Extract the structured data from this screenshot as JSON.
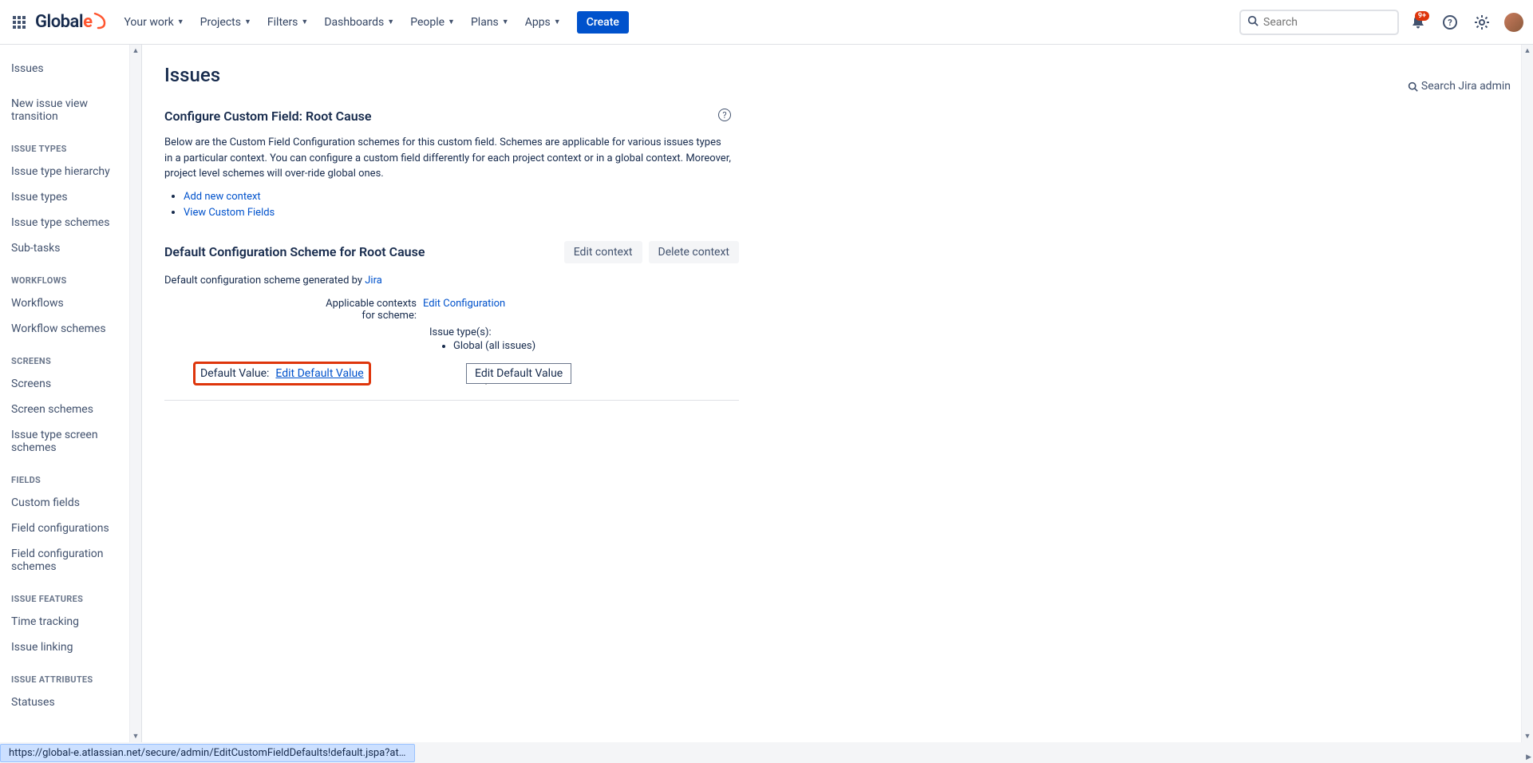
{
  "nav": {
    "logo1": "Global",
    "logo2": "e",
    "items": [
      "Your work",
      "Projects",
      "Filters",
      "Dashboards",
      "People",
      "Plans",
      "Apps"
    ],
    "create": "Create",
    "search_placeholder": "Search",
    "badge": "9+"
  },
  "admin_search": "Search Jira admin",
  "sidebar": {
    "head": "Issues",
    "new_view": "New issue view transition",
    "sections": [
      {
        "title": "ISSUE TYPES",
        "items": [
          "Issue type hierarchy",
          "Issue types",
          "Issue type schemes",
          "Sub-tasks"
        ]
      },
      {
        "title": "WORKFLOWS",
        "items": [
          "Workflows",
          "Workflow schemes"
        ]
      },
      {
        "title": "SCREENS",
        "items": [
          "Screens",
          "Screen schemes",
          "Issue type screen schemes"
        ]
      },
      {
        "title": "FIELDS",
        "items": [
          "Custom fields",
          "Field configurations",
          "Field configuration schemes"
        ]
      },
      {
        "title": "ISSUE FEATURES",
        "items": [
          "Time tracking",
          "Issue linking"
        ]
      },
      {
        "title": "ISSUE ATTRIBUTES",
        "items": [
          "Statuses"
        ]
      }
    ]
  },
  "main": {
    "title": "Issues",
    "sub_header": "Configure Custom Field: Root Cause",
    "desc": "Below are the Custom Field Configuration schemes for this custom field. Schemes are applicable for various issues types in a particular context. You can configure a custom field differently for each project context or in a global context. Moreover, project level schemes will over-ride global ones.",
    "links": [
      "Add new context",
      "View Custom Fields"
    ],
    "scheme_header": "Default Configuration Scheme for Root Cause",
    "edit_ctx": "Edit context",
    "delete_ctx": "Delete context",
    "generated_by": "Default configuration scheme generated by ",
    "jira": "Jira",
    "applicable_label": "Applicable contexts for scheme:",
    "edit_config": "Edit Configuration",
    "issue_types_label": "Issue type(s):",
    "global_issues": "Global (all issues)",
    "default_value_label": "Default Value:",
    "edit_default_value": "Edit Default Value",
    "tooltip": "Edit Default Value"
  },
  "status_url": "https://global-e.atlassian.net/secure/admin/EditCustomFieldDefaults!default.jspa?atl_token=BAX..."
}
